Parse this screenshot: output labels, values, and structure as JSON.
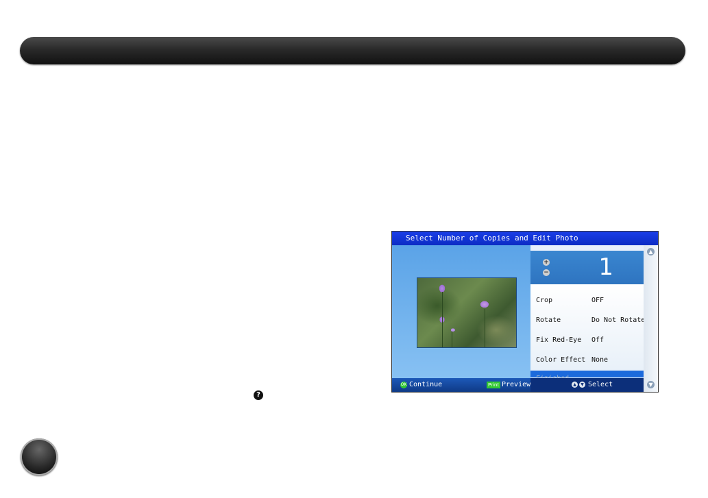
{
  "screen": {
    "title": "Select Number of Copies and Edit Photo",
    "copies": "1",
    "menu": [
      {
        "label": "Crop",
        "value": "OFF"
      },
      {
        "label": "Rotate",
        "value": "Do Not Rotate"
      },
      {
        "label": "Fix Red-Eye",
        "value": "Off"
      },
      {
        "label": "Color Effect",
        "value": "None"
      }
    ],
    "finished_label": "Finished",
    "bottom": {
      "ok_badge": "OK",
      "continue": "Continue",
      "print_badge": "Print",
      "preview": "Preview",
      "select": "Select"
    }
  },
  "help_icon_glyph": "?",
  "icons": [
    "help-icon",
    "plus-icon",
    "minus-icon",
    "scroll-up-icon",
    "scroll-down-icon",
    "ok-icon",
    "up-down-icon"
  ]
}
